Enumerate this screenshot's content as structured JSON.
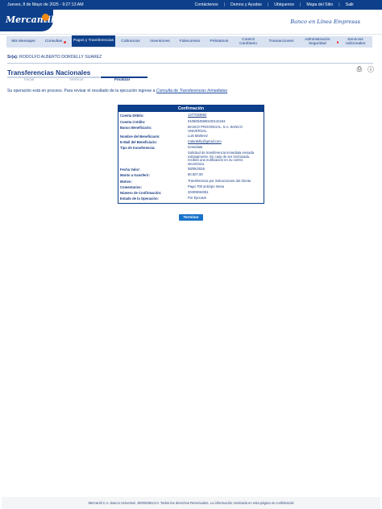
{
  "topbar": {
    "date": "Jueves, 8 de Mayo de 2025 - 9:27:13 AM",
    "links": [
      "Contáctenos",
      "Demos y Ayudas",
      "Ubiquenos",
      "Mapa del Sitio",
      "Salir"
    ]
  },
  "header": {
    "logo_text": "Mercantil",
    "tagline": "Banco en Línea Empresas"
  },
  "nav": {
    "items": [
      "Mis Mensajes",
      "Consultas",
      "Pagos y Transferencias",
      "Cobranzas",
      "Inversiones",
      "Fideicomiso",
      "Préstamos",
      "Control Cambiario",
      "Transacciones",
      "Administración Seguridad",
      "Servicios Adicionales"
    ]
  },
  "user": {
    "label": "Sr(a):",
    "name": "RODOLFO ALBERTO DORDELLY SUAREZ"
  },
  "page": {
    "title": "Transferencias Nacionales",
    "steps": [
      "Iniciar",
      "Verificar",
      "Finalizar"
    ],
    "message_pre": "Su operación está en proceso. Para revisar el resultado de la ejecución ingrese a ",
    "message_link": "Consulta de Transferencias Inmediatas"
  },
  "confirmation": {
    "header": "Confirmación",
    "rows": [
      {
        "k": "Cuenta Débito:",
        "v": "1277033692"
      },
      {
        "k": "Cuenta Crédito:",
        "v": "01080045550100142184"
      },
      {
        "k": "Banco Beneficiario:",
        "v": "BANCO PROVINCIAL, S.A. BANCO UNIVERSAL"
      },
      {
        "k": "Nombre del Beneficiario:",
        "v": "Luis Martinez"
      },
      {
        "k": "E-Mail del Beneficiario:",
        "v": "rodordelly@gmail.com"
      },
      {
        "k": "Tipo de transferencia:",
        "v": "Inmediata"
      },
      {
        "k": "",
        "v": "Solicitud de transferencia inmediata enviada exitosamente. En caso de ser rechazada, recibirá una notificación en su correo electrónico."
      },
      {
        "k": "Fecha Valor:",
        "v": "08/05/2025"
      },
      {
        "k": "Monto a transferir:",
        "v": "80.507,00"
      },
      {
        "k": "Motivo:",
        "v": "Transferencia por instrucciones del cliente"
      },
      {
        "k": "Comentarios:",
        "v": "Pago 700 anticipo mesa"
      },
      {
        "k": "Número de Confirmación:",
        "v": "20409034051"
      },
      {
        "k": "Estado de la Operación:",
        "v": "Por Ejecutar"
      }
    ]
  },
  "buttons": {
    "finish": "Terminar"
  },
  "icons": {
    "print": "print-icon",
    "help": "help-icon"
  },
  "colors": {
    "primary": "#0d3f8a",
    "accent": "#f08a1a",
    "button": "#1a73c9"
  },
  "footer": "Mercantil C.A. Banco Universal. J000029613-0. Todos los derechos Reservados. La información mostrada en esta página es confidencial"
}
